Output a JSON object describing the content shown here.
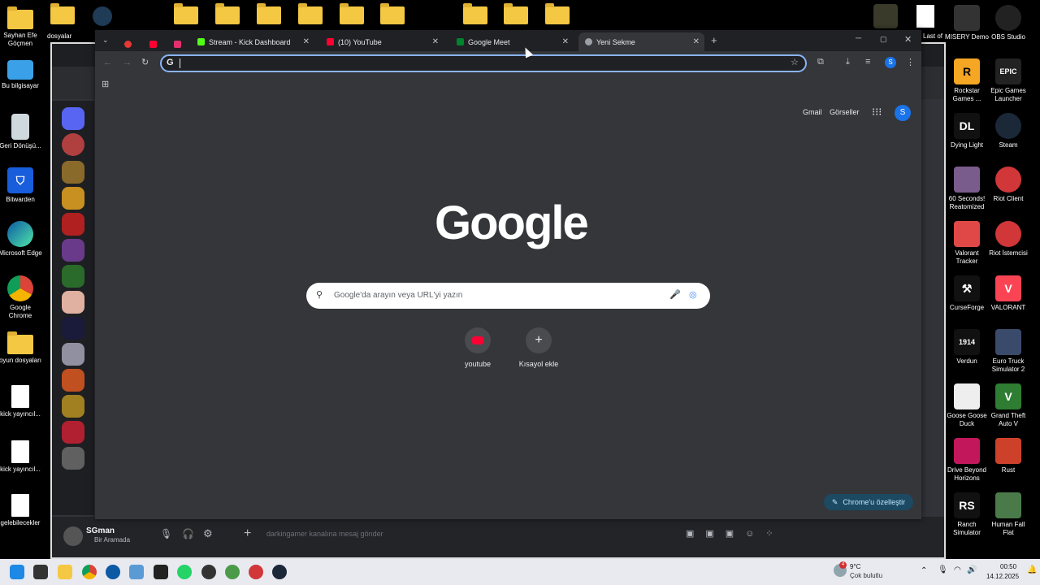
{
  "desktop": {
    "left_icons": [
      {
        "label": "Sayhan Efe Göçmen",
        "icon": "folder-icon"
      },
      {
        "label": "Bu bilgisayar",
        "icon": "computer-icon"
      },
      {
        "label": "Geri Dönüşü...",
        "icon": "recycle-bin-icon"
      },
      {
        "label": "Bitwarden",
        "icon": "bitwarden-icon"
      },
      {
        "label": "Microsoft Edge",
        "icon": "edge-icon"
      },
      {
        "label": "Google Chrome",
        "icon": "chrome-icon"
      },
      {
        "label": "oyun dosyaları",
        "icon": "folder-icon"
      },
      {
        "label": "kick yayıncıl...",
        "icon": "file-icon"
      },
      {
        "label": "kick yayıncıl...",
        "icon": "file-icon"
      },
      {
        "label": "gelebilecekler",
        "icon": "file-icon"
      }
    ],
    "top_icons": [
      {
        "label": "dosyalar"
      }
    ],
    "right_icons": [
      {
        "label": "MISERY Demo",
        "color": "#333333"
      },
      {
        "label": "OBS Studio",
        "color": "#222222"
      },
      {
        "label": "Rockstar Games ...",
        "color": "#f5a623"
      },
      {
        "label": "Epic Games Launcher",
        "color": "#222222"
      },
      {
        "label": "Dying Light",
        "color": "#111111"
      },
      {
        "label": "Steam",
        "color": "#1b2838"
      },
      {
        "label": "60 Seconds! Reatomized",
        "color": "#7a5c8c"
      },
      {
        "label": "Riot Client",
        "color": "#d13639"
      },
      {
        "label": "Valorant Tracker",
        "color": "#e04848"
      },
      {
        "label": "Riot İstemcisi",
        "color": "#d13639"
      },
      {
        "label": "CurseForge",
        "color": "#111111"
      },
      {
        "label": "VALORANT",
        "color": "#fa4454"
      },
      {
        "label": "Verdun",
        "color": "#111111"
      },
      {
        "label": "Euro Truck Simulator 2",
        "color": "#3a4a6a"
      },
      {
        "label": "Goose Goose Duck",
        "color": "#eeeeee"
      },
      {
        "label": "Grand Theft Auto V",
        "color": "#2e7d32"
      },
      {
        "label": "Drive Beyond Horizons",
        "color": "#c2185b"
      },
      {
        "label": "Rust",
        "color": "#cd412b"
      },
      {
        "label": "Ranch Simulator",
        "color": "#111111"
      },
      {
        "label": "Human Fall Flat",
        "color": "#4a7a4a"
      }
    ],
    "last_of_label": "Last of"
  },
  "discord": {
    "user_name": "SGman",
    "user_status": "Bir Aramada",
    "message_placeholder": "darkingamer kanalına mesaj gönder"
  },
  "chrome": {
    "tabs": [
      {
        "title": "Stream - Kick Dashboard",
        "icon": "kick-icon",
        "color": "#53fc18"
      },
      {
        "title": "(10) YouTube",
        "icon": "youtube-icon",
        "color": "#ff0033"
      },
      {
        "title": "Google Meet",
        "icon": "meet-icon",
        "color": "#00832d"
      },
      {
        "title": "Yeni Sekme",
        "icon": "chrome-icon",
        "color": "#9aa0a6"
      }
    ],
    "omnibox_value": "",
    "header_links": {
      "gmail": "Gmail",
      "images": "Görseller",
      "avatar_letter": "S"
    },
    "profile_letter": "S",
    "logo": "Google",
    "search_placeholder": "Google'da arayın veya URL'yi yazın",
    "shortcuts": [
      {
        "label": "youtube",
        "icon": "youtube-icon"
      },
      {
        "label": "Kısayol ekle",
        "icon": "plus-icon"
      }
    ],
    "customize_label": "Chrome'u özelleştir"
  },
  "taskbar": {
    "weather_temp": "9°C",
    "weather_desc": "Çok bulutlu",
    "weather_badge": "4",
    "time": "00:50",
    "date": "14.12.2025"
  }
}
